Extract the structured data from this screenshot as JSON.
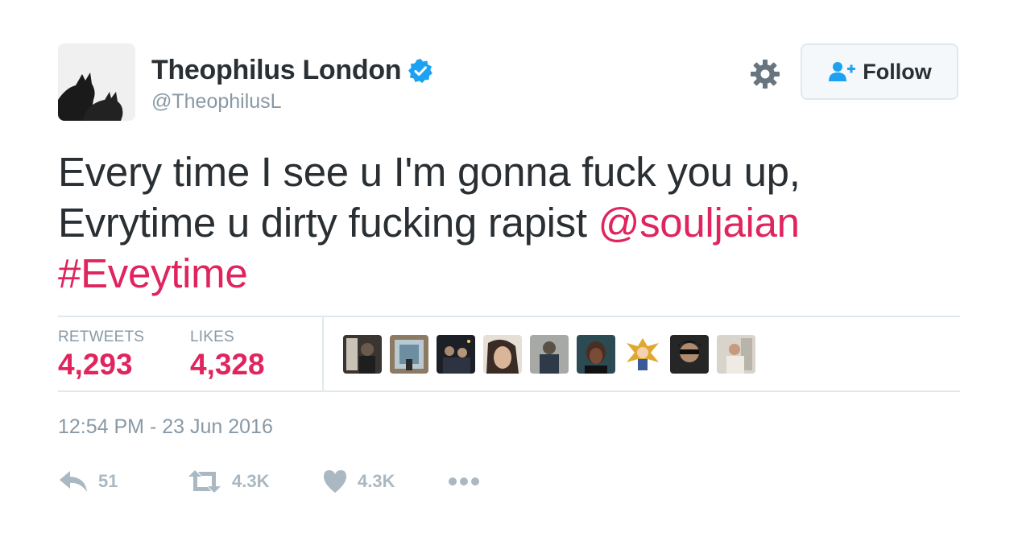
{
  "user": {
    "name": "Theophilus London",
    "handle": "@TheophilusL",
    "verified": true,
    "verified_color": "#1da1f2"
  },
  "header": {
    "settings_icon": "gear-icon",
    "follow_label": "Follow",
    "follow_icon": "person-plus-icon"
  },
  "tweet": {
    "line1": "Every time I see u I'm gonna fuck you up,",
    "line2_text": "Evrytime u dirty fucking rapist ",
    "mention": "@souljaian",
    "hashtag": "#Eveytime",
    "link_color": "#e0245e"
  },
  "stats": {
    "retweets_label": "RETWEETS",
    "retweets_value": "4,293",
    "likes_label": "LIKES",
    "likes_value": "4,328"
  },
  "likers": [
    {
      "icon": "liker-avatar-1"
    },
    {
      "icon": "liker-avatar-2"
    },
    {
      "icon": "liker-avatar-3"
    },
    {
      "icon": "liker-avatar-4"
    },
    {
      "icon": "liker-avatar-5"
    },
    {
      "icon": "liker-avatar-6"
    },
    {
      "icon": "liker-avatar-7"
    },
    {
      "icon": "liker-avatar-8"
    },
    {
      "icon": "liker-avatar-9"
    }
  ],
  "timestamp": "12:54 PM - 23 Jun 2016",
  "actions": {
    "reply_count": "51",
    "retweet_count": "4.3K",
    "like_count": "4.3K",
    "more_icon": "more-dots-icon"
  },
  "colors": {
    "text": "#292f33",
    "muted": "#8899a6",
    "accent": "#e0245e",
    "action": "#aab8c2"
  }
}
